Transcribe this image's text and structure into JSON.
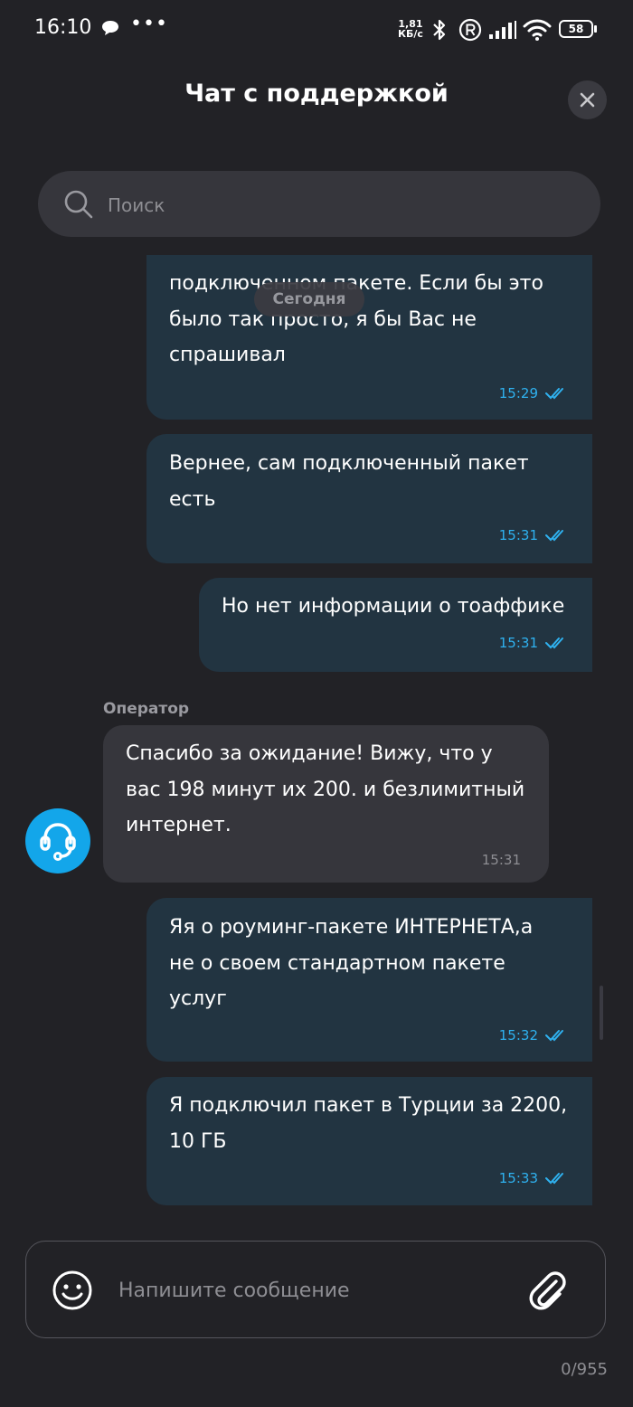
{
  "status_bar": {
    "time": "16:10",
    "speed_value": "1,81",
    "speed_unit": "КБ/с",
    "battery": "58",
    "icons": [
      "chat-bubble-icon",
      "more-dots-icon",
      "bluetooth-icon",
      "roaming-r-icon",
      "signal-icon",
      "wifi-icon",
      "battery-icon"
    ]
  },
  "header": {
    "title": "Чат с поддержкой"
  },
  "search": {
    "placeholder": "Поиск"
  },
  "date_separator": "Сегодня",
  "messages": [
    {
      "text": "подключенном пакете. Если бы это\nбыло так просто, я бы Вас не\nспрашивал",
      "time": "15:29",
      "direction": "out",
      "status": "read"
    },
    {
      "text": "Вернее, сам подключенный пакет\nесть",
      "time": "15:31",
      "direction": "out",
      "status": "read"
    },
    {
      "text": "Но нет информации о тоаффике",
      "time": "15:31",
      "direction": "out",
      "status": "read"
    },
    {
      "sender": "Оператор",
      "text": "Спасибо за ожидание! Вижу, что у\nвас 198 минут их 200. и безлимитный\nинтернет.",
      "time": "15:31",
      "direction": "in"
    },
    {
      "text": "Яя о роуминг-пакете ИНТЕРНЕТА,а\nне о своем стандартном пакете\nуслуг",
      "time": "15:32",
      "direction": "out",
      "status": "read"
    },
    {
      "text": "Я подключил пакет в Турции за 2200,\n10 ГБ",
      "time": "15:33",
      "direction": "out",
      "status": "read"
    }
  ],
  "composer": {
    "placeholder": "Напишите сообщение",
    "counter": "0/955"
  },
  "colors": {
    "background": "#222226",
    "outgoing_bubble": "#223441",
    "incoming_bubble": "#36363c",
    "accent": "#2fb2f0",
    "avatar": "#13a6ea"
  }
}
